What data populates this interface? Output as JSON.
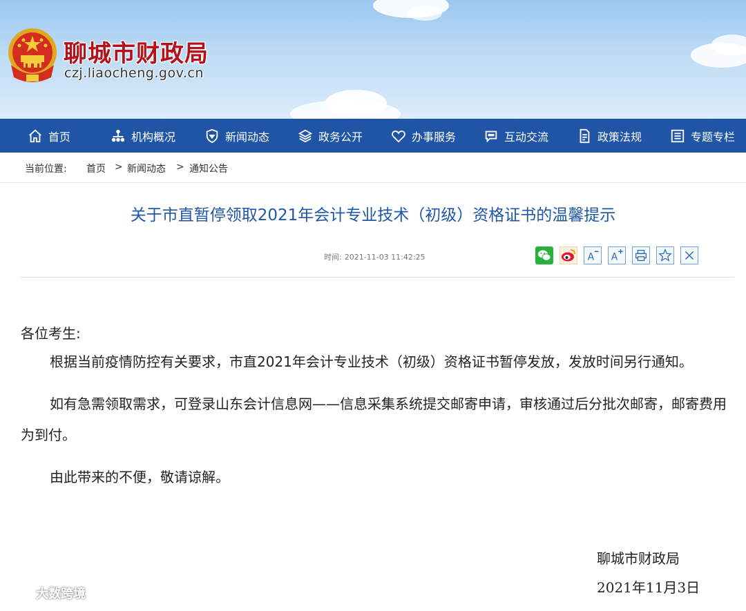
{
  "header": {
    "site_title": "聊城市财政局",
    "site_domain": "czj.liaocheng.gov.cn"
  },
  "nav": {
    "items": [
      {
        "label": "首页",
        "icon": "home-icon"
      },
      {
        "label": "机构概况",
        "icon": "org-chart-icon"
      },
      {
        "label": "新闻动态",
        "icon": "news-icon"
      },
      {
        "label": "政务公开",
        "icon": "layers-icon"
      },
      {
        "label": "办事服务",
        "icon": "heart-icon"
      },
      {
        "label": "互动交流",
        "icon": "chat-icon"
      },
      {
        "label": "政策法规",
        "icon": "document-icon"
      },
      {
        "label": "专题专栏",
        "icon": "list-icon"
      }
    ]
  },
  "breadcrumb": {
    "prefix": "当前位置:",
    "home": "首页",
    "level1": "新闻动态",
    "level2": "通知公告",
    "separator": ">"
  },
  "article": {
    "title": "关于市直暂停领取2021年会计专业技术（初级）资格证书的温馨提示",
    "time_label": "时间:",
    "time_value": "2021-11-03 11:42:25",
    "greeting": "各位考生:",
    "paragraphs": [
      "根据当前疫情防控有关要求，市直2021年会计专业技术（初级）资格证书暂停发放，发放时间另行通知。",
      "如有急需领取需求，可登录山东会计信息网——信息采集系统提交邮寄申请，审核通过后分批次邮寄，邮寄费用为到付。",
      "由此带来的不便，敬请谅解。"
    ],
    "signature": "聊城市财政局",
    "date": "2021年11月3日"
  },
  "share_icons": [
    "wechat-icon",
    "weibo-icon",
    "font-decrease-icon",
    "font-increase-icon",
    "print-icon",
    "favorite-icon",
    "close-icon"
  ],
  "watermark": "大数跨境",
  "colors": {
    "nav_bg": "#1f55a4",
    "title_blue": "#1f57a8",
    "site_title_red": "#b4121b"
  }
}
